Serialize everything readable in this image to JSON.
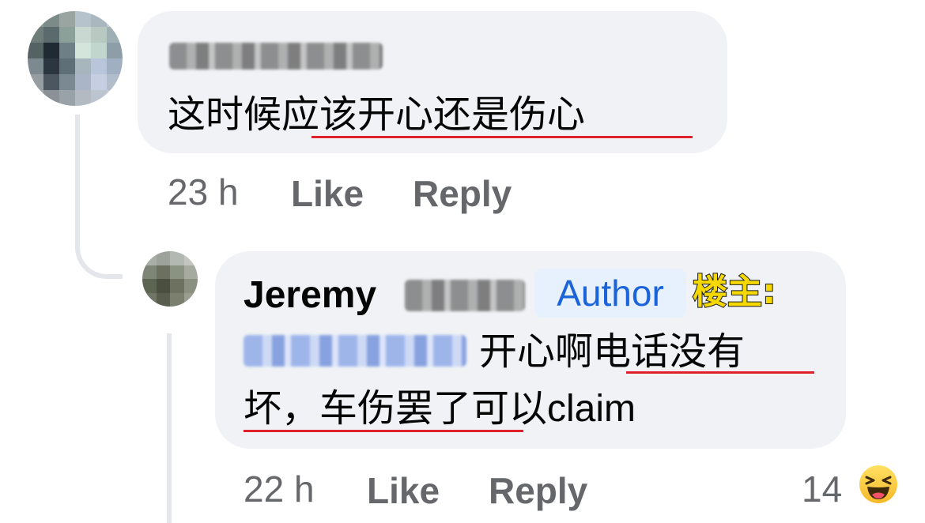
{
  "comments": [
    {
      "text": "这时候应该开心还是伤心",
      "time": "23 h",
      "like_label": "Like",
      "reply_label": "Reply"
    },
    {
      "author_name": "Jeremy",
      "author_badge": "Author",
      "op_label": "楼主:",
      "text_line1": "开心啊电话没有",
      "text_line2": "坏，车伤罢了可以claim",
      "time": "22 h",
      "like_label": "Like",
      "reply_label": "Reply",
      "reaction_count": "14",
      "reaction_icon": "haha-emoji-icon"
    }
  ],
  "colors": {
    "bubble": "#f0f2f5",
    "meta_text": "#65676b",
    "badge_bg": "#e7f0fd",
    "badge_text": "#1b63d8",
    "underline": "#e0202a"
  }
}
